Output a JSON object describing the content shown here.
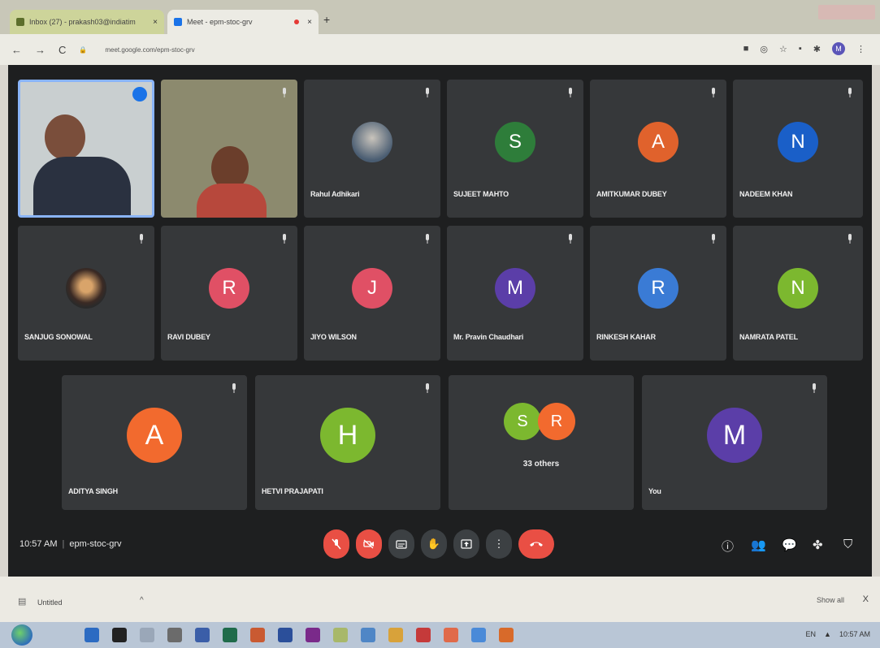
{
  "browser": {
    "tabs": [
      {
        "title": "Inbox (27) - prakash03@indiatim",
        "active": false,
        "favicon_color": "#5c6e2b"
      },
      {
        "title": "Meet - epm-stoc-grv",
        "active": true,
        "favicon_color": "#1a73e8"
      }
    ],
    "new_tab_label": "+",
    "url": "meet.google.com/epm-stoc-grv",
    "nav": {
      "back": "←",
      "forward": "→",
      "reload": "C"
    },
    "profile_initial": "M"
  },
  "meet": {
    "tiles": [
      {
        "name": "",
        "kind": "video",
        "bg": "#c9cfd0",
        "speaking": true
      },
      {
        "name": "",
        "kind": "video",
        "bg": "#8c8a6e",
        "speaking": false
      },
      {
        "name": "Rahul Adhikari",
        "kind": "photo",
        "bg": "#6a7c8c"
      },
      {
        "name": "SUJEET MAHTO",
        "kind": "initial",
        "initial": "S",
        "color": "#2e7d3a"
      },
      {
        "name": "AMITKUMAR DUBEY",
        "kind": "initial",
        "initial": "A",
        "color": "#e0622c"
      },
      {
        "name": "NADEEM KHAN",
        "kind": "initial",
        "initial": "N",
        "color": "#1a5fc8"
      },
      {
        "name": "SANJUG SONOWAL",
        "kind": "photo",
        "bg": "#5a4f48"
      },
      {
        "name": "RAVI DUBEY",
        "kind": "initial",
        "initial": "R",
        "color": "#e05065"
      },
      {
        "name": "JIYO WILSON",
        "kind": "initial",
        "initial": "J",
        "color": "#e05065"
      },
      {
        "name": "Mr. Pravin Chaudhari",
        "kind": "initial",
        "initial": "M",
        "color": "#5b3ea8"
      },
      {
        "name": "RINKESH KAHAR",
        "kind": "initial",
        "initial": "R",
        "color": "#3a7bd5"
      },
      {
        "name": "NAMRATA PATEL",
        "kind": "initial",
        "initial": "N",
        "color": "#7cb82f"
      },
      {
        "name": "ADITYA SINGH",
        "kind": "initial",
        "initial": "A",
        "color": "#f26a2e"
      },
      {
        "name": "HETVI PRAJAPATI",
        "kind": "initial",
        "initial": "H",
        "color": "#7cb82f"
      },
      {
        "name": "33 others",
        "kind": "group",
        "initials": [
          "S",
          "R"
        ],
        "colors": [
          "#7cb82f",
          "#f26a2e"
        ]
      },
      {
        "name": "You",
        "kind": "initial",
        "initial": "M",
        "color": "#5b3ea8"
      }
    ],
    "bottom": {
      "time": "10:57 AM",
      "separator": "|",
      "meeting_code": "epm-stoc-grv"
    }
  },
  "download_bar": {
    "file_name": "Untitled",
    "chevron": "^",
    "show_all": "Show all",
    "close": "X"
  },
  "taskbar": {
    "clock": "10:57 AM",
    "tray_label": "EN"
  }
}
